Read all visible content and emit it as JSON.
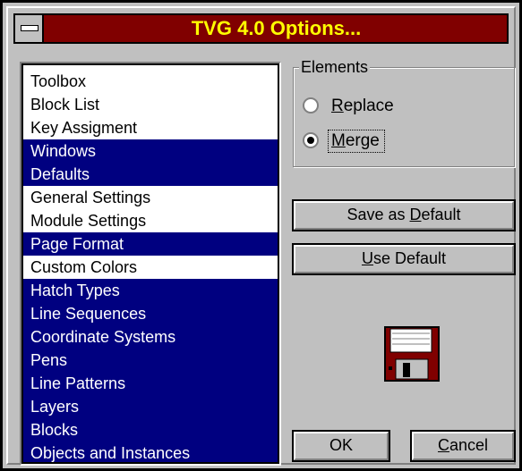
{
  "window": {
    "title": "TVG 4.0 Options..."
  },
  "list": {
    "items": [
      {
        "label": "Toolbox",
        "selected": false
      },
      {
        "label": "Block List",
        "selected": false
      },
      {
        "label": "Key Assigment",
        "selected": false
      },
      {
        "label": "Windows",
        "selected": true
      },
      {
        "label": "Defaults",
        "selected": true
      },
      {
        "label": "General Settings",
        "selected": false
      },
      {
        "label": "Module Settings",
        "selected": false
      },
      {
        "label": "Page Format",
        "selected": true
      },
      {
        "label": "Custom Colors",
        "selected": false
      },
      {
        "label": "Hatch Types",
        "selected": true
      },
      {
        "label": "Line Sequences",
        "selected": true
      },
      {
        "label": "Coordinate Systems",
        "selected": true
      },
      {
        "label": "Pens",
        "selected": true
      },
      {
        "label": "Line Patterns",
        "selected": true
      },
      {
        "label": "Layers",
        "selected": true
      },
      {
        "label": "Blocks",
        "selected": true
      },
      {
        "label": "Objects and Instances",
        "selected": true
      }
    ]
  },
  "elements": {
    "group_label": "Elements",
    "replace": {
      "pre": "",
      "mnemonic": "R",
      "post": "eplace",
      "checked": false
    },
    "merge": {
      "pre": "",
      "mnemonic": "M",
      "post": "erge",
      "checked": true
    }
  },
  "buttons": {
    "save_default": {
      "pre": "Save as ",
      "mnemonic": "D",
      "post": "efault"
    },
    "use_default": {
      "pre": "",
      "mnemonic": "U",
      "post": "se Default"
    },
    "ok": {
      "pre": "",
      "mnemonic": "",
      "post": "OK"
    },
    "cancel": {
      "pre": "",
      "mnemonic": "C",
      "post": "ancel"
    }
  },
  "icons": {
    "disk": "floppy-disk-icon",
    "sysmenu": "system-menu-icon"
  },
  "colors": {
    "title_bg": "#800000",
    "title_text": "#ffff00",
    "selection": "#000080",
    "face": "#c0c0c0"
  }
}
